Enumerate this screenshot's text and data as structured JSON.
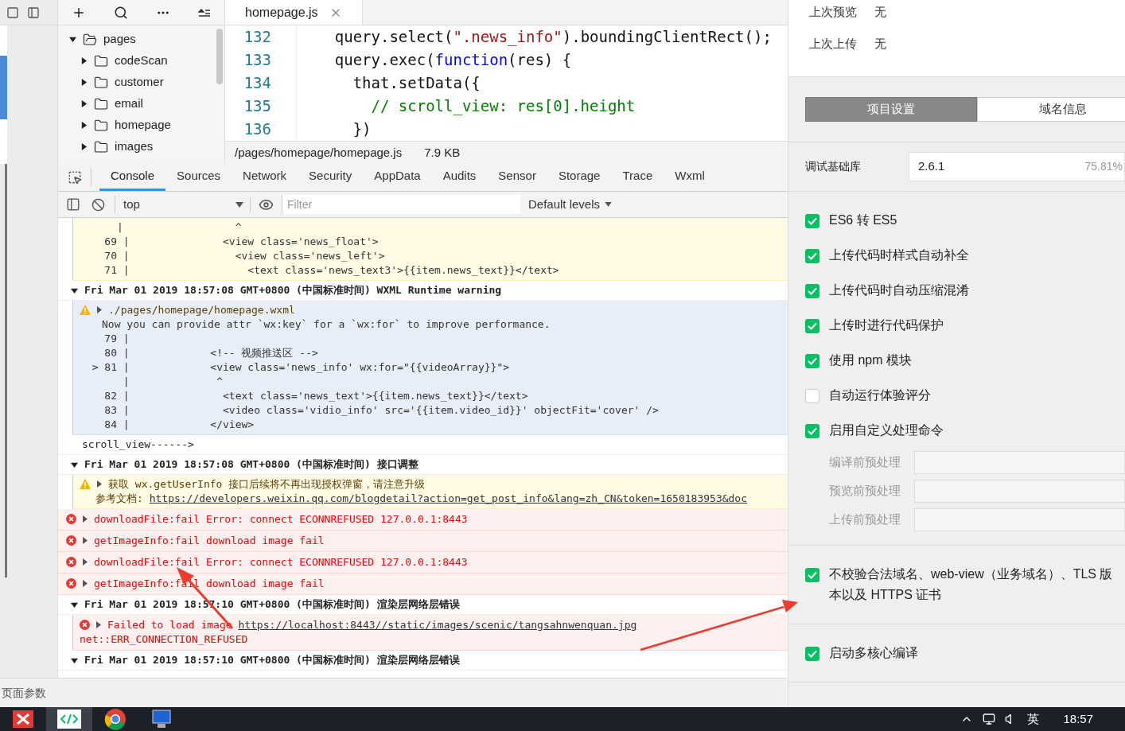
{
  "file_tree": {
    "items": [
      {
        "label": "pages",
        "expanded": true,
        "children": [
          {
            "label": "codeScan",
            "expanded": false
          },
          {
            "label": "customer",
            "expanded": false
          },
          {
            "label": "email",
            "expanded": false
          },
          {
            "label": "homepage",
            "expanded": false
          },
          {
            "label": "images",
            "expanded": false
          }
        ]
      }
    ]
  },
  "editor": {
    "tab": "homepage.js",
    "lines": [
      {
        "number": "132",
        "tokens": [
          {
            "kind": "plain",
            "text": "    query.select("
          },
          {
            "kind": "string",
            "text": "\".news_info\""
          },
          {
            "kind": "plain",
            "text": ").boundingClientRect();"
          }
        ]
      },
      {
        "number": "133",
        "tokens": [
          {
            "kind": "plain",
            "text": "    query.exec("
          },
          {
            "kind": "keyword",
            "text": "function"
          },
          {
            "kind": "plain",
            "text": "(res) {"
          }
        ]
      },
      {
        "number": "134",
        "tokens": [
          {
            "kind": "plain",
            "text": "      that.setData({"
          }
        ]
      },
      {
        "number": "135",
        "tokens": [
          {
            "kind": "comment",
            "text": "        // scroll_view: res[0].height"
          }
        ]
      },
      {
        "number": "136",
        "tokens": [
          {
            "kind": "plain",
            "text": "      })"
          }
        ]
      }
    ],
    "status": {
      "path": "/pages/homepage/homepage.js",
      "size": "7.9 KB"
    }
  },
  "devtools": {
    "tabs": [
      {
        "label": "Console",
        "selected": true
      },
      {
        "label": "Sources",
        "selected": false
      },
      {
        "label": "Network",
        "selected": false
      },
      {
        "label": "Security",
        "selected": false
      },
      {
        "label": "AppData",
        "selected": false
      },
      {
        "label": "Audits",
        "selected": false
      },
      {
        "label": "Sensor",
        "selected": false
      },
      {
        "label": "Storage",
        "selected": false
      },
      {
        "label": "Trace",
        "selected": false
      },
      {
        "label": "Wxml",
        "selected": false
      }
    ],
    "context": "top",
    "filter_placeholder": "Filter",
    "levels": "Default levels",
    "messages": [
      {
        "kind": "warning",
        "hovered": false,
        "lines": [
          "      |                  ^",
          "    69 |               <view class='news_float'>",
          "    70 |                 <view class='news_left'>",
          "    71 |                   <text class='news_text3'>{{item.news_text}}</text>"
        ]
      },
      {
        "kind": "group",
        "expanded": true,
        "text": "Fri Mar 01 2019 18:57:08 GMT+0800 (中国标准时间) WXML Runtime warning"
      },
      {
        "kind": "warning",
        "hovered": true,
        "title": "./pages/homepage/homepage.wxml",
        "body": "Now you can provide attr `wx:key` for a `wx:for` to improve performance.",
        "lines": [
          "    79 |",
          "    80 |             <!-- 视频推送区 -->",
          "  > 81 |             <view class='news_info' wx:for=\"{{videoArray}}\">",
          "       |              ^",
          "    82 |               <text class='news_text'>{{item.news_text}}</text>",
          "    83 |               <video class='vidio_info' src='{{item.video_id}}' objectFit='cover' />",
          "    84 |             </view>"
        ]
      },
      {
        "kind": "log",
        "text": "scroll_view------>"
      },
      {
        "kind": "group",
        "expanded": true,
        "text": "Fri Mar 01 2019 18:57:08 GMT+0800 (中国标准时间) 接口调整"
      },
      {
        "kind": "warning",
        "hovered": false,
        "title": "获取 wx.getUserInfo 接口后续将不再出现授权弹窗，请注意升级",
        "ref_label": "参考文档: ",
        "link": "https://developers.weixin.qq.com/blogdetail?action=get_post_info&lang=zh_CN&token=1650183953&doc"
      },
      {
        "kind": "error",
        "text": "downloadFile:fail Error: connect ECONNREFUSED 127.0.0.1:8443"
      },
      {
        "kind": "error",
        "text": "getImageInfo:fail download image fail"
      },
      {
        "kind": "error",
        "text": "downloadFile:fail Error: connect ECONNREFUSED 127.0.0.1:8443"
      },
      {
        "kind": "error",
        "text": "getImageInfo:fail download image fail"
      },
      {
        "kind": "group",
        "expanded": true,
        "text": "Fri Mar 01 2019 18:57:10 GMT+0800 (中国标准时间) 渲染层网络层错误"
      },
      {
        "kind": "error",
        "nested": true,
        "text": "Failed to load image ",
        "link": "https://localhost:8443//static/images/scenic/tangsahnwenquan.jpg",
        "detail": "net::ERR_CONNECTION_REFUSED"
      },
      {
        "kind": "group",
        "expanded": true,
        "text": "Fri Mar 01 2019 18:57:10 GMT+0800 (中国标准时间) 渲染层网络层错误"
      }
    ]
  },
  "bottom_bar": {
    "label": "页面参数"
  },
  "settings": {
    "info": [
      {
        "label": "上次预览",
        "value": "无"
      },
      {
        "label": "上次上传",
        "value": "无"
      }
    ],
    "segments": [
      {
        "label": "项目设置",
        "selected": true
      },
      {
        "label": "域名信息",
        "selected": false
      }
    ],
    "library": {
      "label": "调试基础库",
      "value": "2.6.1",
      "share": "75.81%"
    },
    "groups": [
      {
        "items": [
          {
            "kind": "checkbox",
            "label": "ES6 转 ES5",
            "checked": true
          },
          {
            "kind": "checkbox",
            "label": "上传代码时样式自动补全",
            "checked": true
          },
          {
            "kind": "checkbox",
            "label": "上传代码时自动压缩混淆",
            "checked": true
          },
          {
            "kind": "checkbox",
            "label": "上传时进行代码保护",
            "checked": true
          },
          {
            "kind": "checkbox",
            "label": "使用 npm 模块",
            "checked": true
          },
          {
            "kind": "checkbox",
            "label": "自动运行体验评分",
            "checked": false
          },
          {
            "kind": "checkbox",
            "label": "启用自定义处理命令",
            "checked": true
          },
          {
            "kind": "command",
            "label": "编译前预处理"
          },
          {
            "kind": "command",
            "label": "预览前预处理"
          },
          {
            "kind": "command",
            "label": "上传前预处理"
          }
        ]
      },
      {
        "items": [
          {
            "kind": "checkbox",
            "label": "不校验合法域名、web-view（业务域名）、TLS 版本以及 HTTPS 证书",
            "checked": true
          }
        ]
      },
      {
        "items": [
          {
            "kind": "checkbox",
            "label": "启动多核心编译",
            "checked": true
          }
        ]
      }
    ]
  },
  "taskbar": {
    "apps": [
      {
        "kind": "tool",
        "selected": false
      },
      {
        "kind": "devtools",
        "selected": true
      },
      {
        "kind": "browser",
        "selected": false
      },
      {
        "kind": "computer",
        "selected": false
      }
    ],
    "ime": "英",
    "time": "18:57"
  }
}
